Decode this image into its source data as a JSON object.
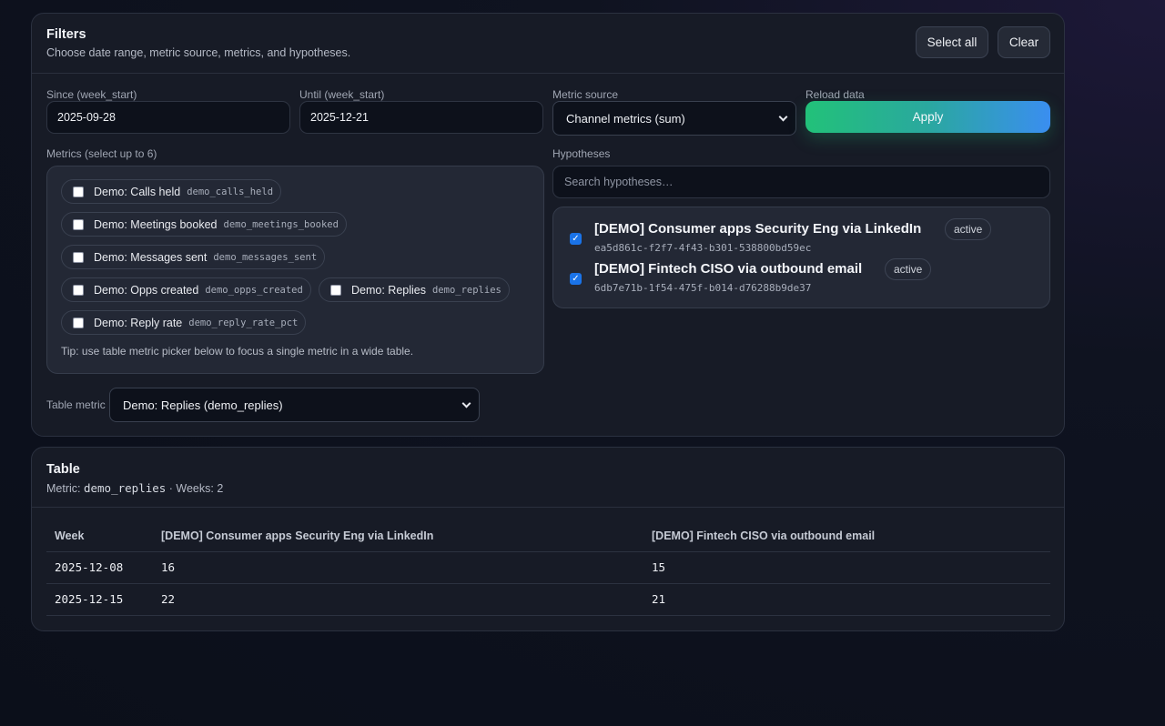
{
  "filters": {
    "title": "Filters",
    "subtitle": "Choose date range, metric source, metrics, and hypotheses.",
    "select_all_label": "Select all",
    "clear_label": "Clear",
    "since": {
      "label": "Since (week_start)",
      "value": "2025-09-28"
    },
    "until": {
      "label": "Until (week_start)",
      "value": "2025-12-21"
    },
    "metric_source": {
      "label": "Metric source",
      "selected": "Channel metrics (sum)"
    },
    "reload": {
      "label": "Reload data",
      "button": "Apply"
    },
    "metrics": {
      "label": "Metrics (select up to 6)",
      "items": [
        {
          "name": "Demo: Calls held",
          "code": "demo_calls_held",
          "checked": false
        },
        {
          "name": "Demo: Meetings booked",
          "code": "demo_meetings_booked",
          "checked": false
        },
        {
          "name": "Demo: Messages sent",
          "code": "demo_messages_sent",
          "checked": false
        },
        {
          "name": "Demo: Opps created",
          "code": "demo_opps_created",
          "checked": false
        },
        {
          "name": "Demo: Replies",
          "code": "demo_replies",
          "checked": false
        },
        {
          "name": "Demo: Reply rate",
          "code": "demo_reply_rate_pct",
          "checked": false
        }
      ],
      "tip": "Tip: use table metric picker below to focus a single metric in a wide table."
    },
    "hypotheses": {
      "label": "Hypotheses",
      "search_placeholder": "Search hypotheses…",
      "items": [
        {
          "name": "[DEMO] Consumer apps Security Eng via LinkedIn",
          "id": "ea5d861c-f2f7-4f43-b301-538800bd59ec",
          "status": "active",
          "checked": true
        },
        {
          "name": "[DEMO] Fintech CISO via outbound email",
          "id": "6db7e71b-1f54-475f-b014-d76288b9de37",
          "status": "active",
          "checked": true
        }
      ]
    },
    "table_metric": {
      "label": "Table metric",
      "selected": "Demo: Replies (demo_replies)"
    }
  },
  "table": {
    "title": "Table",
    "metric_prefix": "Metric: ",
    "metric_code": "demo_replies",
    "weeks_suffix": " · Weeks: 2",
    "columns": [
      "Week",
      "[DEMO] Consumer apps Security Eng via LinkedIn",
      "[DEMO] Fintech CISO via outbound email"
    ],
    "rows": [
      [
        "2025-12-08",
        "16",
        "15"
      ],
      [
        "2025-12-15",
        "22",
        "21"
      ]
    ]
  }
}
